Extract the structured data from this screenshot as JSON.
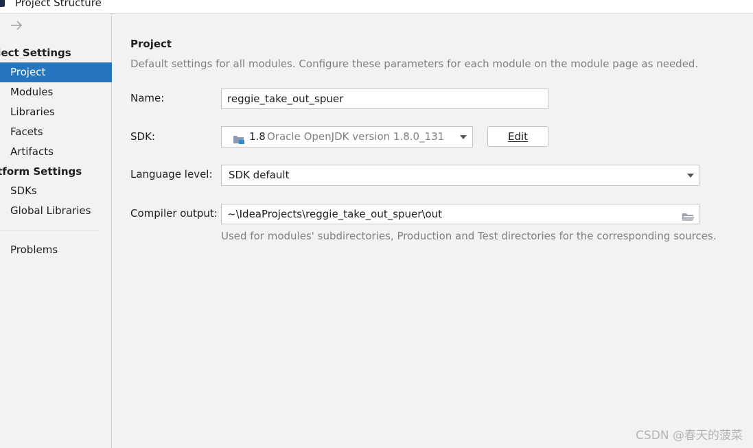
{
  "window": {
    "title": "Project Structure"
  },
  "sidebar": {
    "back_icon": "arrow-right-icon",
    "project_settings_header": "oject Settings",
    "project_settings_items": [
      {
        "label": "Project",
        "selected": true
      },
      {
        "label": "Modules"
      },
      {
        "label": "Libraries"
      },
      {
        "label": "Facets"
      },
      {
        "label": "Artifacts"
      }
    ],
    "platform_settings_header": "atform Settings",
    "platform_settings_items": [
      {
        "label": "SDKs"
      },
      {
        "label": "Global Libraries"
      }
    ],
    "problems_label": "Problems"
  },
  "main": {
    "title": "Project",
    "description": "Default settings for all modules. Configure these parameters for each module on the module page as needed.",
    "name_label": "Name:",
    "name_value": "reggie_take_out_spuer",
    "sdk_label": "SDK:",
    "sdk_version": "1.8",
    "sdk_detail": "Oracle OpenJDK version 1.8.0_131",
    "edit_button": "Edit",
    "language_level_label": "Language level:",
    "language_level_value": "SDK default",
    "compiler_output_label": "Compiler output:",
    "compiler_output_value": "~\\IdeaProjects\\reggie_take_out_spuer\\out",
    "compiler_output_hint": "Used for modules' subdirectories, Production and Test directories for the corresponding sources."
  },
  "watermark": "CSDN @春天的菠菜",
  "colors": {
    "selection": "#2675bf",
    "background": "#f2f2f2",
    "muted_text": "#808080"
  }
}
